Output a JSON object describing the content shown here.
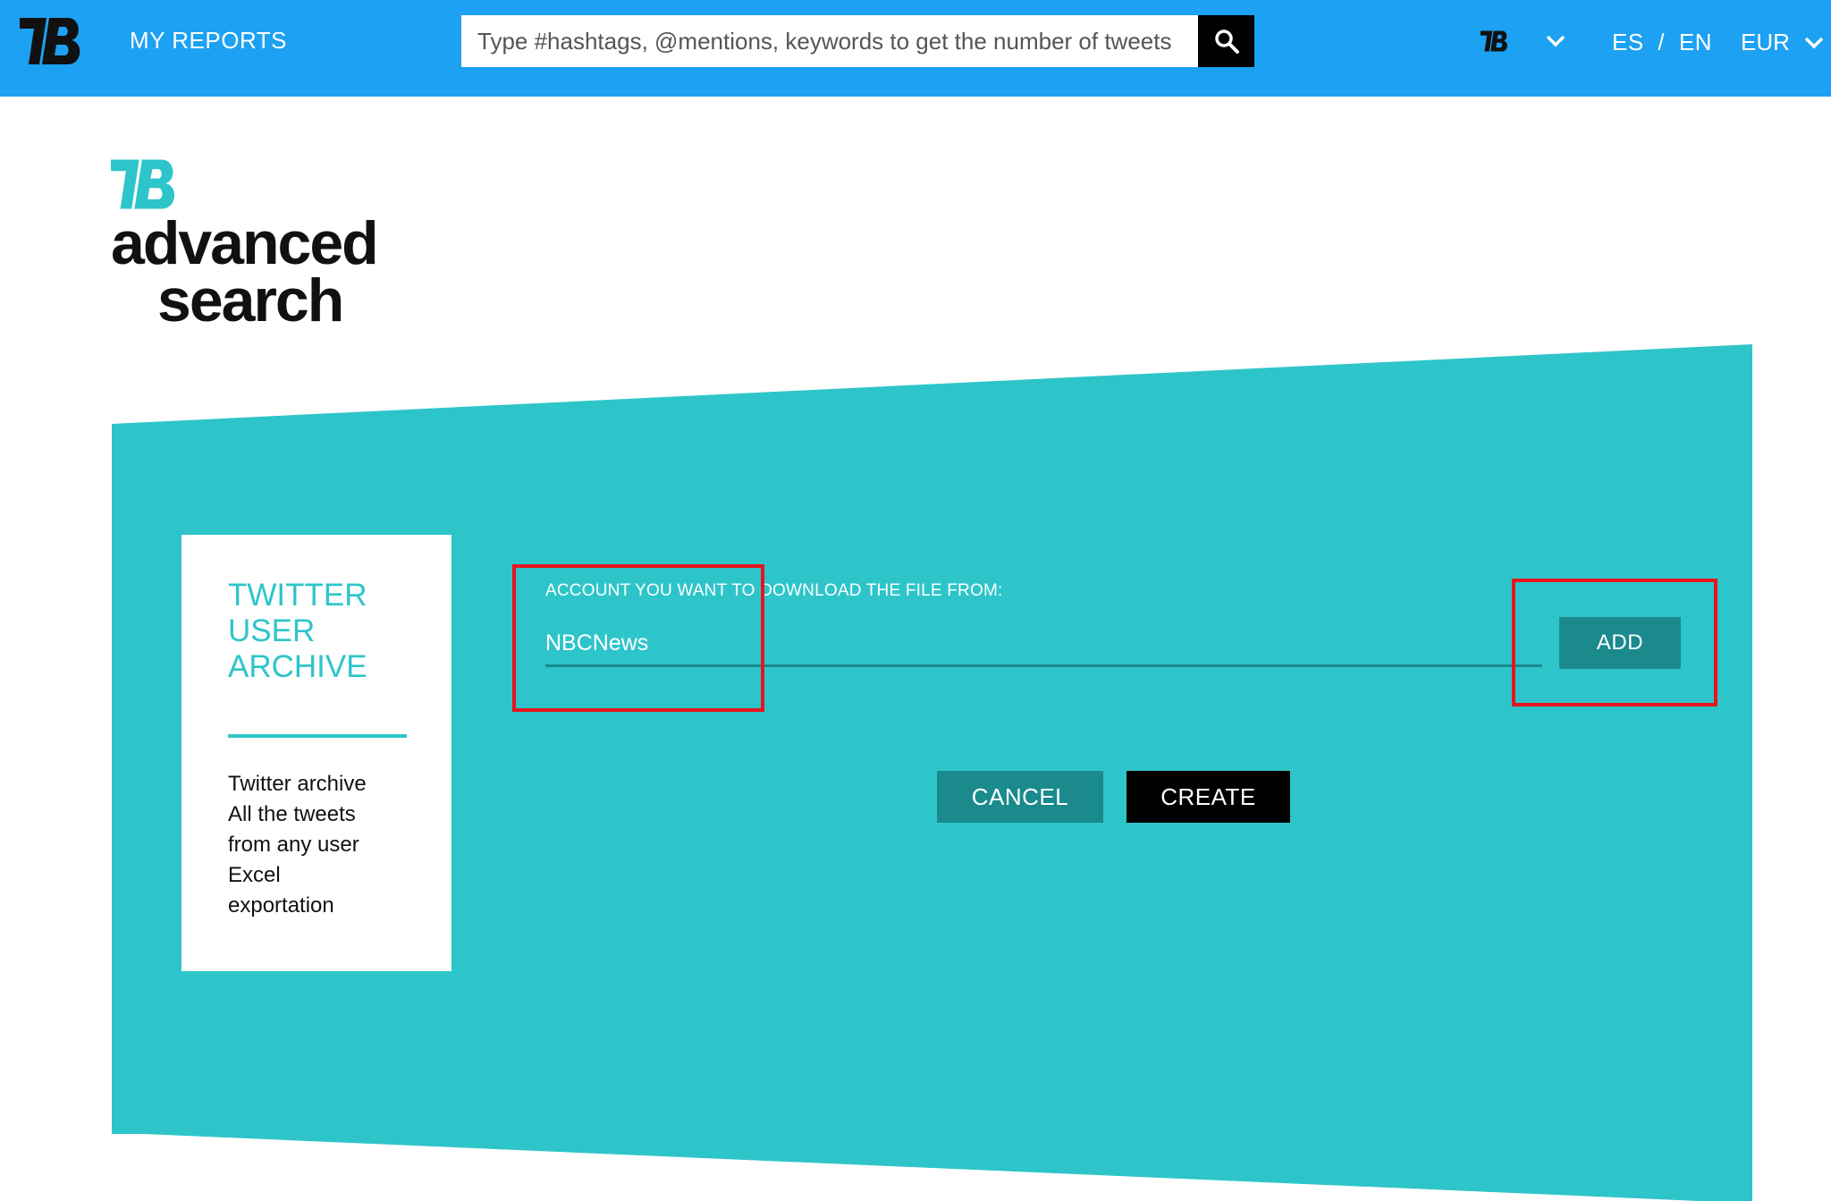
{
  "header": {
    "nav_my_reports": "MY REPORTS",
    "search_placeholder": "Type #hashtags, @mentions, keywords to get the number of tweets",
    "lang_es": "ES",
    "lang_sep": "/",
    "lang_en": "EN",
    "currency": "EUR"
  },
  "hero": {
    "title_line1": "advanced",
    "title_line2": "search"
  },
  "card": {
    "title_lines": [
      "TWITTER",
      "USER",
      "ARCHIVE"
    ],
    "desc_lines": [
      "Twitter archive",
      "All the tweets",
      "from any user",
      "Excel",
      "exportation"
    ]
  },
  "form": {
    "account_label": "ACCOUNT YOU WANT TO DOWNLOAD THE FILE FROM:",
    "account_value": "NBCNews",
    "add_label": "ADD",
    "cancel_label": "CANCEL",
    "create_label": "CREATE"
  },
  "icons": {
    "brand_logo": "tb-logo-icon",
    "search": "search-icon",
    "dropdown": "chevron-down-icon"
  },
  "colors": {
    "header_bg": "#1da1f2",
    "panel_teal": "#2ec5ca",
    "button_teal": "#1a8a8d",
    "create_black": "#000000",
    "annotation_red": "#e8141d"
  }
}
